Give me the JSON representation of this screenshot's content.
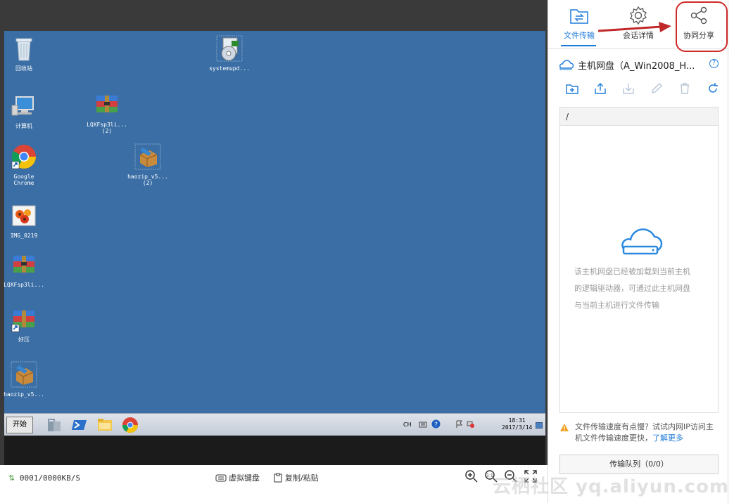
{
  "desktop": {
    "icons": [
      {
        "label": "回收站",
        "label2": ""
      },
      {
        "label": "计算机",
        "label2": ""
      },
      {
        "label": "Google",
        "label2": "Chrome"
      },
      {
        "label": "IMG_0219",
        "label2": ""
      },
      {
        "label": "LQXFsp3li...",
        "label2": ""
      },
      {
        "label": "好压",
        "label2": ""
      },
      {
        "label": "haozip_v5...",
        "label2": ""
      },
      {
        "label": "systemupd...",
        "label2": ""
      },
      {
        "label": "LQXFsp3li...",
        "label2": "(2)"
      },
      {
        "label": "haozip_v5...",
        "label2": "(2)"
      }
    ]
  },
  "taskbar": {
    "start_label": "开始",
    "lang": "CH",
    "time": "18:31",
    "date": "2017/3/14"
  },
  "statusbar": {
    "speed": "0001/0000KB/S",
    "virtual_keyboard": "虚拟键盘",
    "copy_paste": "复制/粘贴"
  },
  "panel": {
    "tabs": [
      {
        "label": "文件传输",
        "icon": "folder-transfer-icon",
        "active": true
      },
      {
        "label": "会话详情",
        "icon": "gear-icon",
        "active": false
      },
      {
        "label": "协同分享",
        "icon": "share-icon",
        "active": false
      }
    ],
    "disk_title": "主机网盘（A_Win2008_H...",
    "path": "/",
    "empty_line1": "该主机网盘已经被加载到当前主机",
    "empty_line2": "的逻辑驱动器，可通过此主机网盘",
    "empty_line3": "与当前主机进行文件传输",
    "notice_text": "文件传输速度有点慢？试试内网IP访问主机文件传输速度更快，",
    "notice_link": "了解更多",
    "queue_label": "传输队列（0/0）"
  },
  "watermark": "云栖社区 yq.aliyun.com",
  "colors": {
    "accent": "#1f7bd8",
    "desktop": "#3a6ea5",
    "highlight": "#d02a2a"
  }
}
